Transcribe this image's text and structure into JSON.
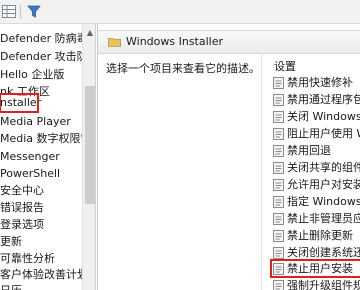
{
  "toolbar": {
    "buttons": [
      {
        "name": "grid-view-icon"
      },
      {
        "name": "filter-icon"
      }
    ]
  },
  "tree": {
    "items": [
      {
        "label": "Defender 防病毒程"
      },
      {
        "label": "Defender 攻击防护"
      },
      {
        "label": "Hello 企业版"
      },
      {
        "label": "nk 工作区"
      },
      {
        "label": "nstaller",
        "selected": true
      },
      {
        "label": "Media Player"
      },
      {
        "label": "Media 数字权限管理"
      },
      {
        "label": "Messenger"
      },
      {
        "label": "PowerShell"
      },
      {
        "label": "安全中心"
      },
      {
        "label": "错误报告"
      },
      {
        "label": "登录选项"
      },
      {
        "label": "更新"
      },
      {
        "label": "可靠性分析"
      },
      {
        "label": "客户体验改善计划"
      },
      {
        "label": "日历"
      }
    ]
  },
  "panel": {
    "title": "Windows Installer",
    "description": "选择一个项目来查看它的描述。",
    "settings_header": "设置",
    "settings": [
      {
        "label": "禁用快速修补"
      },
      {
        "label": "禁用通过程序包访"
      },
      {
        "label": "关闭 Windows In"
      },
      {
        "label": "阻止用户使用 Wi"
      },
      {
        "label": "禁用回退"
      },
      {
        "label": "关闭共享的组件"
      },
      {
        "label": "允许用户对安装进"
      },
      {
        "label": "指定 Windows In"
      },
      {
        "label": "禁止非管理员应用"
      },
      {
        "label": "禁止删除更新"
      },
      {
        "label": "关闭创建系统还原"
      },
      {
        "label": "禁止用户安装",
        "highlight": true
      },
      {
        "label": "强制升级组件规则"
      }
    ]
  },
  "colors": {
    "highlight_border": "#e02020",
    "header_bg": "#e9ecef",
    "folder": "#e8c25a"
  }
}
